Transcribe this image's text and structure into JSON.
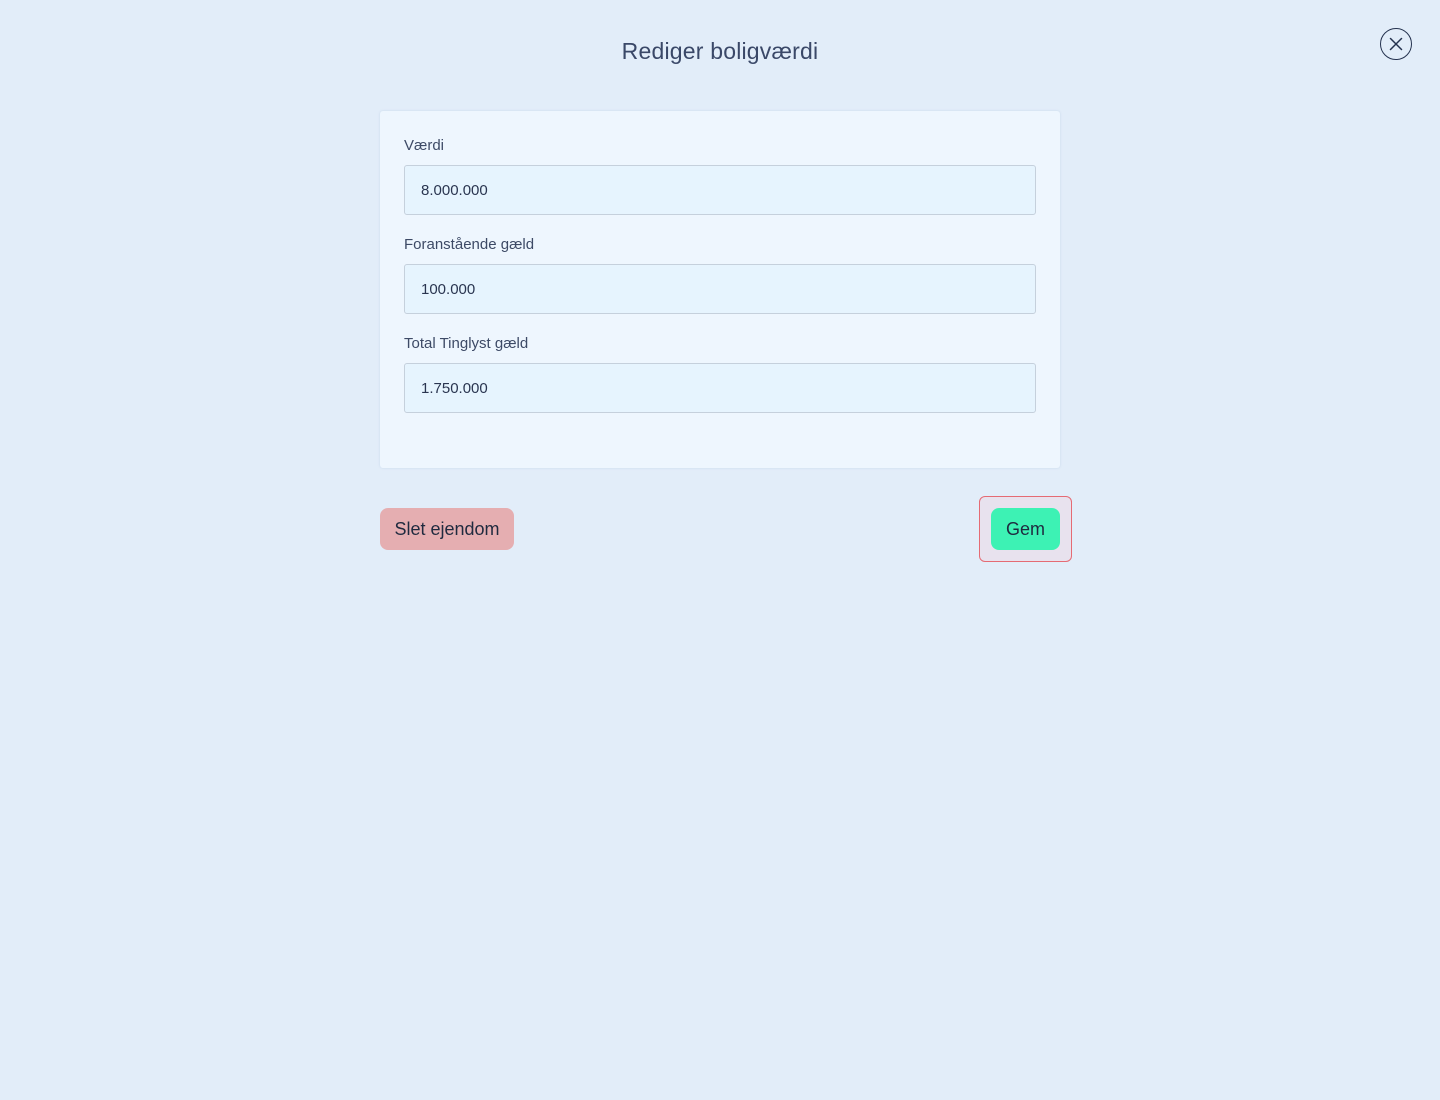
{
  "modal": {
    "title": "Rediger boligværdi",
    "close_icon": "close-icon"
  },
  "form": {
    "fields": [
      {
        "label": "Værdi",
        "value": "8.000.000"
      },
      {
        "label": "Foranstående gæld",
        "value": "100.000"
      },
      {
        "label": "Total Tinglyst gæld",
        "value": "1.750.000"
      }
    ]
  },
  "actions": {
    "delete_label": "Slet ejendom",
    "save_label": "Gem"
  },
  "colors": {
    "background": "#e2edf9",
    "card": "#eef6fe",
    "delete_button": "#e5aeb1",
    "save_button": "#3df2b4",
    "focus_ring": "#e56b74"
  }
}
